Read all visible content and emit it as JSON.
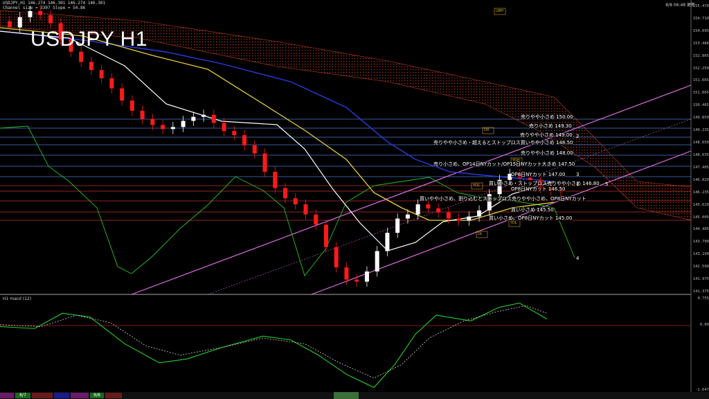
{
  "window": {
    "header_line1": "USDJPY,H1  146.274 146.301 146.274 146.301",
    "header_line2": "Channel size = 3307 Slope = 54.86",
    "top_right": "8/8 06:48 更新",
    "title": "USDJPY H1",
    "indicator_title": "H1 macd (12)"
  },
  "price_axis": [
    "155.470",
    "154.710",
    "154.095",
    "153.480",
    "152.865",
    "152.250",
    "151.665",
    "151.065",
    "150.465",
    "149.850",
    "149.235",
    "148.650",
    "148.035",
    "147.405",
    "146.820",
    "146.235",
    "145.620",
    "145.005",
    "144.405",
    "143.790",
    "143.190",
    "142.590",
    "141.975",
    "141.375"
  ],
  "macd_axis": [
    "0.755",
    "0.00",
    "-1.647"
  ],
  "levels": [
    {
      "label": "売りやや小さめ 150.00",
      "color": "#4a78d0"
    },
    {
      "label": "売り小さめ 149.30",
      "color": "#4a78d0"
    },
    {
      "label": "売りやや小さめ 149.00",
      "color": "#4a78d0"
    },
    {
      "label": "売りやや小さめ・超えるとストップロス買いやや小さめ 148.50",
      "color": "#4a78d0"
    },
    {
      "label": "売りやや小さめ 148.00",
      "color": "#4a78d0"
    },
    {
      "label": "売り小さめ、OP14日NYカット/OP15日NYカット大きめ 147.50",
      "color": "#4a78d0"
    },
    {
      "label": "OP8日NYカット 147.00",
      "color": "#4a78d0"
    },
    {
      "label": "買い小さめ・ストップロス売りやや小さめ 146.80",
      "color": "#c03030"
    },
    {
      "label": "OP8日NYカット 146.50",
      "color": "#c03030"
    },
    {
      "label": "買いやや小さめ、割り込むとストップロス売りやや小さめ、OP8日NYカット",
      "color": "#c03030"
    },
    {
      "label": "買い小さめ 145.50",
      "color": "#c03030"
    },
    {
      "label": "買い小さめ、OP8日NYカット 145.00",
      "color": "#c03030"
    }
  ],
  "markers": {
    "m1": "1",
    "m2": "2",
    "m3": "3",
    "m4": "4",
    "m5": "5",
    "ldh": "LWH",
    "ydh": "YDH",
    "ydl": "YDL",
    "ydc": "YDC",
    "dl": "DL",
    "dh": "DH"
  },
  "bottom_bar": {
    "d1": "8/7",
    "d2": "8/8"
  },
  "colors": {
    "candle_up": "#ffffff",
    "candle_down": "#ff1a1a",
    "kumo": "#d94a20",
    "chikou": "#22c422",
    "ma_white": "#ffffff",
    "ma_yellow": "#e8d23a",
    "ma_blue": "#2a3ae0",
    "channel": "#e070e0",
    "macd_line": "#28d028",
    "signal": "#d0d0d0"
  },
  "chart_data": {
    "type": "line",
    "title": "USDJPY H1",
    "candles_close": [
      154.4,
      154.9,
      155.2,
      155.0,
      154.6,
      153.8,
      153.2,
      152.7,
      152.3,
      151.9,
      151.4,
      150.8,
      150.3,
      149.9,
      149.6,
      149.4,
      149.5,
      149.8,
      150.0,
      150.1,
      149.7,
      149.3,
      149.1,
      148.6,
      148.2,
      147.3,
      146.5,
      146.0,
      145.7,
      145.2,
      144.7,
      143.6,
      142.6,
      142.0,
      141.9,
      142.4,
      143.4,
      144.3,
      145.0,
      145.2,
      145.7,
      145.5,
      145.3,
      145.0,
      144.9,
      145.1,
      145.4,
      146.2,
      146.9,
      147.2,
      147.0,
      146.9,
      146.5,
      146.4,
      146.3
    ],
    "ylim": [
      141.375,
      155.47
    ],
    "macd_ylim": [
      -1.647,
      0.755
    ]
  }
}
